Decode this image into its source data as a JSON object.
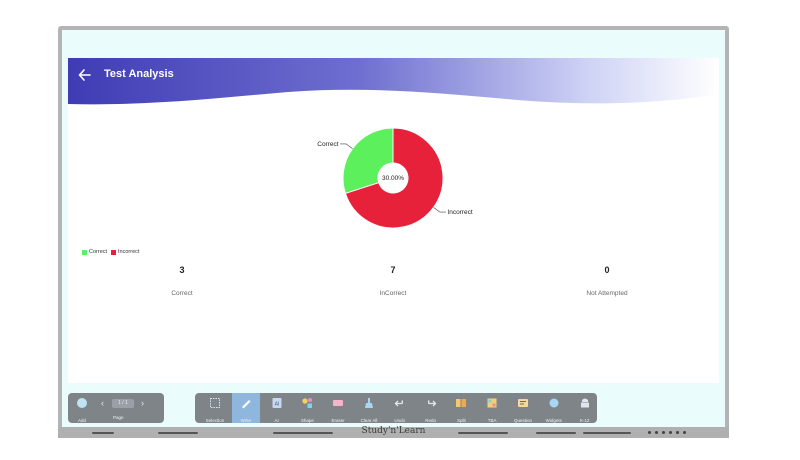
{
  "header": {
    "title": "Test Analysis"
  },
  "chart_data": {
    "type": "pie",
    "variant": "donut",
    "slices": [
      {
        "label": "Correct",
        "value": 3,
        "color": "#5cf05c"
      },
      {
        "label": "Incorrect",
        "value": 7,
        "color": "#e8213b"
      }
    ],
    "center_label": "30.00%",
    "legend": [
      "Correct",
      "Incorrect"
    ],
    "legend_position": "bottom-left"
  },
  "stats": [
    {
      "value": "3",
      "label": "Correct"
    },
    {
      "value": "7",
      "label": "InCorrect"
    },
    {
      "value": "0",
      "label": "Not Attempted"
    }
  ],
  "toolbar_left": {
    "add_label": "Add",
    "page_label": "Page",
    "page_indicator": "1 / 1"
  },
  "toolbar": [
    {
      "label": "Selection",
      "icon": "selection-icon"
    },
    {
      "label": "Write",
      "icon": "pen-icon",
      "active": true
    },
    {
      "label": "AI",
      "icon": "ai-icon"
    },
    {
      "label": "Shape",
      "icon": "shape-icon"
    },
    {
      "label": "Eraser",
      "icon": "eraser-icon"
    },
    {
      "label": "Clear All",
      "icon": "clear-all-icon"
    },
    {
      "label": "Undo",
      "icon": "undo-icon"
    },
    {
      "label": "Redo",
      "icon": "redo-icon"
    },
    {
      "label": "Split",
      "icon": "split-icon"
    },
    {
      "label": "TBA",
      "icon": "book-icon"
    },
    {
      "label": "Question",
      "icon": "question-icon"
    },
    {
      "label": "Widgets",
      "icon": "widgets-icon"
    },
    {
      "label": "K-12",
      "icon": "k12-icon"
    }
  ],
  "device": {
    "brand": "Study'n'Learn"
  }
}
